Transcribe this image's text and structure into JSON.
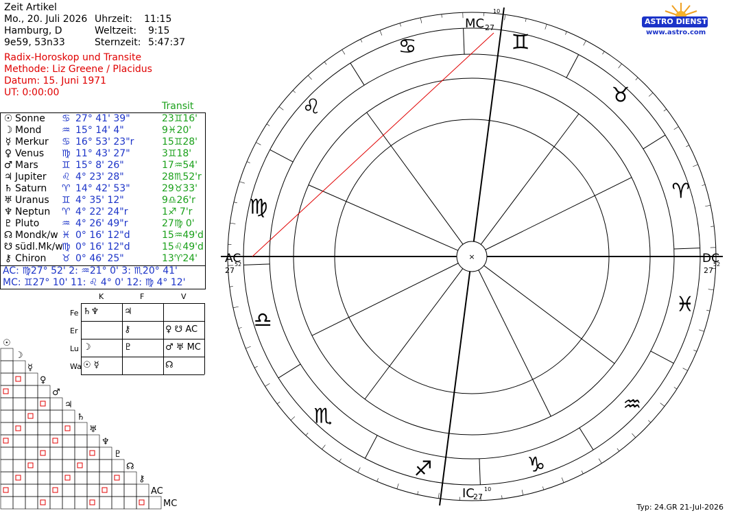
{
  "header": {
    "title": "Zeit Artikel",
    "date": "Mo., 20. Juli 2026",
    "place": "Hamburg, D",
    "coords": "9e59, 53n33",
    "uhrzeit_label": "Uhrzeit:",
    "uhrzeit_value": "11:15",
    "weltzeit_label": "Weltzeit:",
    "weltzeit_value": "9:15",
    "sternzeit_label": "Sternzeit:",
    "sternzeit_value": "5:47:37",
    "chart_type": "Radix-Horoskop und Transite",
    "method": "Methode: Liz Greene / Placidus",
    "datum": "Datum: 15. Juni 1971",
    "ut": "UT:  0:00:00"
  },
  "table": {
    "transit_header": "Transit",
    "rows": [
      {
        "glyph": "☉",
        "name": "Sonne",
        "sign": "♋",
        "pos": "27° 41' 39\"",
        "transit": "23♊16'"
      },
      {
        "glyph": "☽",
        "name": "Mond",
        "sign": "♒",
        "pos": "15° 14'  4\"",
        "transit": "9♓20'"
      },
      {
        "glyph": "☿",
        "name": "Merkur",
        "sign": "♋",
        "pos": "16° 53' 23\"r",
        "transit": "15♊28'"
      },
      {
        "glyph": "♀",
        "name": "Venus",
        "sign": "♍",
        "pos": "11° 43' 27\"",
        "transit": "3♊18'"
      },
      {
        "glyph": "♂",
        "name": "Mars",
        "sign": "♊",
        "pos": "15°  8' 26\"",
        "transit": "17♒54'"
      },
      {
        "glyph": "♃",
        "name": "Jupiter",
        "sign": "♌",
        "pos": "  4° 23' 28\"",
        "transit": "28♏52'r"
      },
      {
        "glyph": "♄",
        "name": "Saturn",
        "sign": "♈",
        "pos": "14° 42' 53\"",
        "transit": "29♉33'"
      },
      {
        "glyph": "♅",
        "name": "Uranus",
        "sign": "♊",
        "pos": "  4° 35' 12\"",
        "transit": "9♎26'r"
      },
      {
        "glyph": "♆",
        "name": "Neptun",
        "sign": "♈",
        "pos": "  4° 22' 24\"r",
        "transit": "1♐ 7'r"
      },
      {
        "glyph": "♇",
        "name": "Pluto",
        "sign": "♒",
        "pos": "  4° 26' 49\"r",
        "transit": "27♍ 0'"
      },
      {
        "glyph": "☊",
        "name": "Mondk/w",
        "sign": "♓",
        "pos": "  0° 16' 12\"d",
        "transit": "15♒49'd"
      },
      {
        "glyph": "☋",
        "name": "südl.Mk/w",
        "sign": "♍",
        "pos": "  0° 16' 12\"d",
        "transit": "15♌49'd"
      },
      {
        "glyph": "⚷",
        "name": "Chiron",
        "sign": "♉",
        "pos": "  0° 46' 25\"",
        "transit": "13♈24'"
      }
    ],
    "angles_line1": "AC: ♍27° 52'   2: ♒21°  0'   3: ♏20° 41'",
    "angles_line2": "MC: ♊27° 10'  11: ♌  4°  0'  12: ♍  4° 12'"
  },
  "elements": {
    "cols": [
      "K",
      "F",
      "V"
    ],
    "rows": [
      {
        "label": "Fe",
        "k": "♄♆",
        "f": "♃",
        "v": ""
      },
      {
        "label": "Er",
        "k": "",
        "f": "⚷",
        "v": "♀ ☋ AC"
      },
      {
        "label": "Lu",
        "k": "☽",
        "f": "♇",
        "v": "♂ ♅ MC"
      },
      {
        "label": "Wa",
        "k": "☉ ☿",
        "f": "",
        "v": "☊"
      }
    ]
  },
  "aspects": {
    "row_labels": [
      "☉",
      "☽",
      "☿",
      "♀",
      "♂",
      "♃",
      "♄",
      "♅",
      "♆",
      "♇",
      "☊",
      "⚷",
      "AC",
      "MC"
    ]
  },
  "wheel": {
    "labels": {
      "mc": "MC",
      "ic": "IC",
      "ac": "AC",
      "dc": "DC",
      "mc_deg": "27",
      "mc_min": "10",
      "ic_deg": "27",
      "ic_min": "10",
      "ac_deg": "27",
      "ac_min": "52",
      "dc_deg": "27",
      "dc_min": "52"
    },
    "signs": [
      "♈",
      "♉",
      "♊",
      "♋",
      "♌",
      "♍",
      "♎",
      "♏",
      "♐",
      "♑",
      "♒",
      "♓"
    ],
    "colors": {
      "radix": "#000000",
      "transit": "#1aa01a",
      "aspect_red": "#e00000",
      "aspect_blue": "#1b33c8"
    }
  },
  "logo": {
    "line1": "ASTRO",
    "line2": "DIENST",
    "url": "www.astro.com"
  },
  "footer": {
    "text": "Typ: 24.GR  21-Jul-2026"
  }
}
